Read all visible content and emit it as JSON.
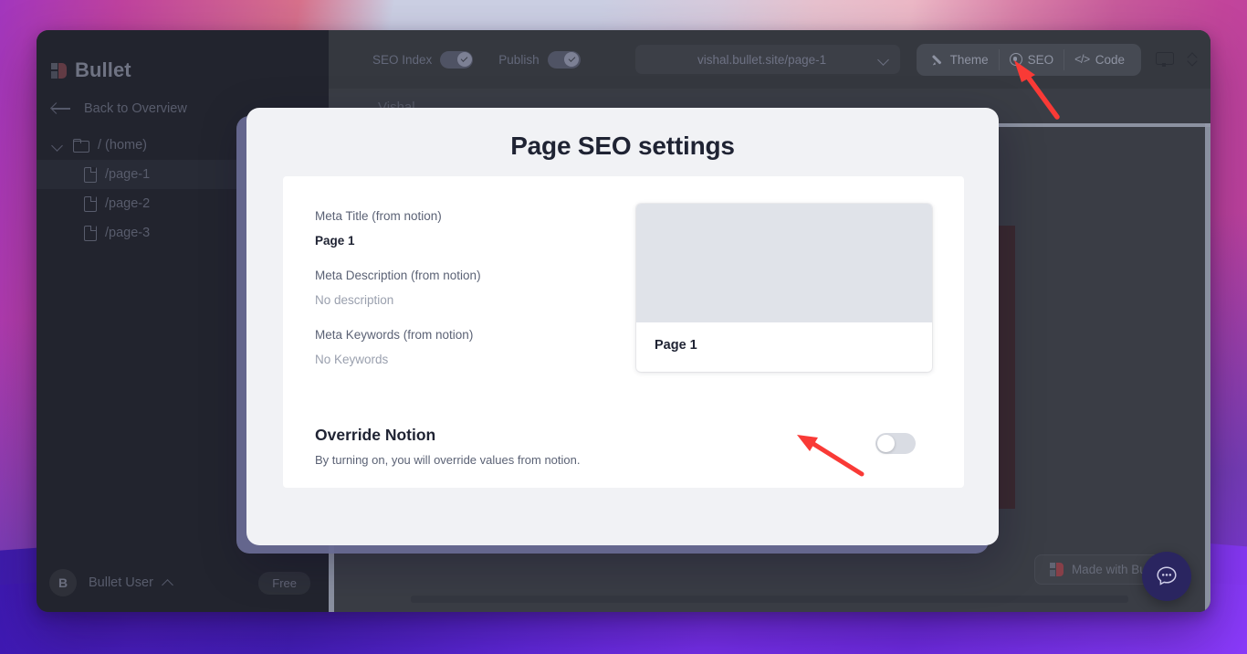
{
  "app": {
    "brand": "Bullet"
  },
  "sidebar": {
    "back_label": "Back to Overview",
    "tree": [
      {
        "label": "/ (home)",
        "type": "folder"
      },
      {
        "label": "/page-1",
        "type": "file"
      },
      {
        "label": "/page-2",
        "type": "file"
      },
      {
        "label": "/page-3",
        "type": "file"
      }
    ],
    "user": {
      "avatar_initial": "B",
      "name": "Bullet User",
      "plan": "Free"
    }
  },
  "topbar": {
    "seo_index_label": "SEO Index",
    "seo_index_on": true,
    "publish_label": "Publish",
    "publish_on": true,
    "url": "vishal.bullet.site/page-1",
    "segments": [
      {
        "label": "Theme",
        "icon": "pencil-icon"
      },
      {
        "label": "SEO",
        "icon": "target-icon"
      },
      {
        "label": "Code",
        "icon": "code-icon"
      }
    ],
    "device_icon": "monitor-icon",
    "device_selector_icon": "up-down-chevron-icon"
  },
  "canvas": {
    "page_heading": "Vishal",
    "made_with": "Made with Bullet",
    "chat_icon": "chat-bubble-icon"
  },
  "modal": {
    "title": "Page SEO settings",
    "fields": [
      {
        "label": "Meta Title (from notion)",
        "value": "Page 1",
        "muted": false
      },
      {
        "label": "Meta Description (from notion)",
        "value": "No description",
        "muted": true
      },
      {
        "label": "Meta Keywords (from notion)",
        "value": "No Keywords",
        "muted": true
      }
    ],
    "preview": {
      "title": "Page 1"
    },
    "override": {
      "heading": "Override Notion",
      "subtext": "By turning on, you will override values from notion.",
      "enabled": false
    }
  },
  "annotations": {
    "arrow_color": "#f93a36",
    "arrow_targets": [
      "seo-tab",
      "override-toggle"
    ]
  }
}
